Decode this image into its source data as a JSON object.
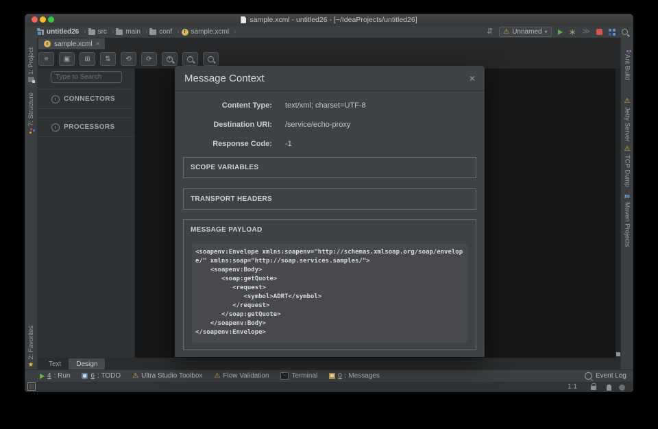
{
  "window": {
    "title": "sample.xcml - untitled26 - [~/IdeaProjects/untitled26]"
  },
  "colors": {
    "traffic_red": "#f96257",
    "traffic_yellow": "#fdbc2e",
    "traffic_green": "#33c748",
    "accent_yellow": "#e3b84b",
    "run_green": "#5caf50",
    "stop_red": "#d1584d",
    "maven_blue": "#6fa8dc"
  },
  "icons": {
    "chevron": "›",
    "caret_down": "▾",
    "warn": "⚠",
    "star": "★",
    "maven_letter": "m",
    "file_letter": "I",
    "settings_sync": "⇵",
    "debug": "∗",
    "coverage": "≫",
    "expand_chevron": "›"
  },
  "breadcrumb": {
    "items": [
      "untitled26",
      "src",
      "main",
      "conf",
      "sample.xcml"
    ]
  },
  "run_widget": {
    "config_name": "Unnamed"
  },
  "editor_tab": {
    "label": "sample.xcml",
    "close": "×"
  },
  "design_toolbar": {
    "glyph_buttons": [
      "≡",
      "▣",
      "⊞",
      "⇅",
      "⟲",
      "⟳"
    ],
    "zoom_in": "+",
    "zoom_out": "−"
  },
  "left_panel": {
    "search_placeholder": "Type to Search",
    "sections": [
      {
        "label": "CONNECTORS"
      },
      {
        "label": "PROCESSORS"
      }
    ]
  },
  "left_stripe": {
    "items": [
      {
        "label": "1: Project"
      },
      {
        "label": "7: Structure"
      },
      {
        "label": "2: Favorites"
      }
    ]
  },
  "right_stripe": {
    "items": [
      {
        "label": "Ant Build"
      },
      {
        "label": "Jetty Server"
      },
      {
        "label": "TCP Dump"
      },
      {
        "label": "Maven Projects"
      }
    ]
  },
  "dialog": {
    "title": "Message Context",
    "close": "×",
    "fields": [
      {
        "label": "Content Type:",
        "value": "text/xml; charset=UTF-8"
      },
      {
        "label": "Destination URI:",
        "value": "/service/echo-proxy"
      },
      {
        "label": "Response Code:",
        "value": "-1"
      }
    ],
    "sections": [
      {
        "label": "SCOPE VARIABLES"
      },
      {
        "label": "TRANSPORT HEADERS"
      },
      {
        "label": "MESSAGE PAYLOAD"
      }
    ],
    "payload_code": "<soapenv:Envelope xmlns:soapenv=\"http://schemas.xmlsoap.org/soap/envelope/\" xmlns:soap=\"http://soap.services.samples/\">\n    <soapenv:Body>\n       <soap:getQuote>\n          <request>\n             <symbol>ADRT</symbol>\n          </request>\n       </soap:getQuote>\n    </soapenv:Body>\n</soapenv:Envelope>"
  },
  "bottom_tabs": [
    {
      "label": "Text"
    },
    {
      "label": "Design"
    }
  ],
  "status_bar": {
    "items": [
      {
        "num": "4",
        "rest": ": Run"
      },
      {
        "num": "6",
        "rest": ": TODO"
      },
      {
        "rest": "Ultra Studio Toolbox"
      },
      {
        "rest": "Flow Validation"
      },
      {
        "rest": "Terminal"
      },
      {
        "num": "0",
        "rest": ": Messages"
      }
    ],
    "event_log": "Event Log"
  },
  "caret_position": "1:1"
}
